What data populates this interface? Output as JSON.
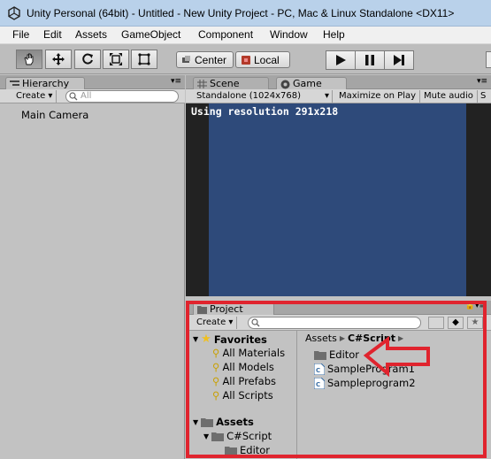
{
  "window": {
    "title": "Unity Personal (64bit) - Untitled - New Unity Project - PC, Mac & Linux Standalone <DX11>"
  },
  "menu": [
    "File",
    "Edit",
    "Assets",
    "GameObject",
    "Component",
    "Window",
    "Help"
  ],
  "toolbar": {
    "tools": [
      "hand-tool",
      "move-tool",
      "rotate-tool",
      "scale-tool",
      "rect-tool"
    ],
    "pivot_label": "Center",
    "space_label": "Local"
  },
  "hierarchy": {
    "tab_label": "Hierarchy",
    "create_label": "Create",
    "search_placeholder": "All",
    "items": [
      "Main Camera"
    ]
  },
  "scene_view": {
    "tabs": [
      "Scene",
      "Game"
    ],
    "resolution_select": "Standalone (1024x768)",
    "maximize_label": "Maximize on Play",
    "mute_label": "Mute audio",
    "stats_label": "S",
    "overlay_text": "Using resolution 291x218",
    "viewport_color": "#2e4a7a"
  },
  "project": {
    "tab_label": "Project",
    "create_label": "Create",
    "favorites_label": "Favorites",
    "favorites": [
      "All Materials",
      "All Models",
      "All Prefabs",
      "All Scripts"
    ],
    "assets_label": "Assets",
    "folders": [
      "C#Script",
      "Editor"
    ],
    "breadcrumb": [
      "Assets",
      "C#Script"
    ],
    "files": [
      "Editor",
      "SampleProgram1",
      "Sampleprogram2"
    ]
  },
  "annotation": {
    "highlight_color": "#e0242e"
  }
}
